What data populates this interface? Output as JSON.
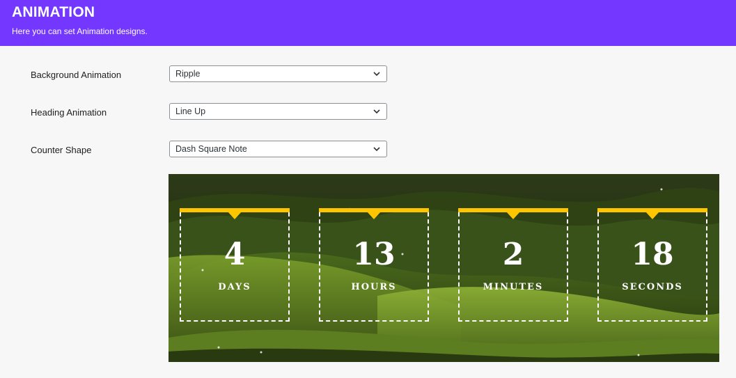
{
  "header": {
    "title": "ANIMATION",
    "subtitle": "Here you can set Animation designs."
  },
  "settings": [
    {
      "label": "Background Animation",
      "value": "Ripple"
    },
    {
      "label": "Heading Animation",
      "value": "Line Up"
    },
    {
      "label": "Counter Shape",
      "value": "Dash Square Note"
    }
  ],
  "preview": {
    "accent_color": "#ffc600",
    "counters": [
      {
        "value": "4",
        "unit": "DAYS"
      },
      {
        "value": "13",
        "unit": "HOURS"
      },
      {
        "value": "2",
        "unit": "MINUTES"
      },
      {
        "value": "18",
        "unit": "SECONDS"
      }
    ]
  },
  "colors": {
    "header_bg": "#7337ff",
    "page_bg": "#f7f7f7"
  },
  "icons": {
    "select_arrow": "chevron-down-icon"
  }
}
